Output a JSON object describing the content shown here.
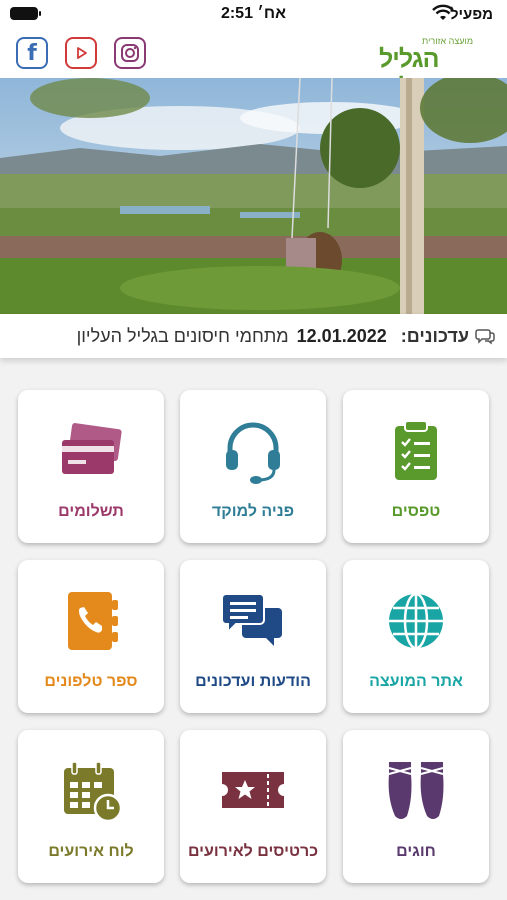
{
  "status_bar": {
    "carrier": "מפעיל",
    "time": "2:51 אח׳"
  },
  "header": {
    "logo_small_text": "מועצה אזורית",
    "logo_text": "הגליל העליון",
    "social": [
      "facebook-icon",
      "youtube-icon",
      "instagram-icon"
    ]
  },
  "news": {
    "label": "עדכונים:",
    "date": "12.01.2022",
    "headline": "מתחמי חיסונים בגליל העליון"
  },
  "tiles": [
    {
      "label": "טפסים",
      "icon": "clipboard-icon",
      "color": "#5a9a2c"
    },
    {
      "label": "פניה למוקד",
      "icon": "headset-icon",
      "color": "#2f7d96"
    },
    {
      "label": "תשלומים",
      "icon": "credit-cards-icon",
      "color": "#9b3a6a"
    },
    {
      "label": "אתר המועצה",
      "icon": "globe-icon",
      "color": "#1aa5a5"
    },
    {
      "label": "הודעות ועדכונים",
      "icon": "chat-bubbles-icon",
      "color": "#1f4a86"
    },
    {
      "label": "ספר טלפונים",
      "icon": "phone-book-icon",
      "color": "#e48a1c"
    },
    {
      "label": "חוגים",
      "icon": "ballet-shoes-icon",
      "color": "#5a3a6e"
    },
    {
      "label": "כרטיסים לאירועים",
      "icon": "ticket-icon",
      "color": "#7a3240"
    },
    {
      "label": "לוח אירועים",
      "icon": "calendar-icon",
      "color": "#7a7a2a"
    }
  ]
}
